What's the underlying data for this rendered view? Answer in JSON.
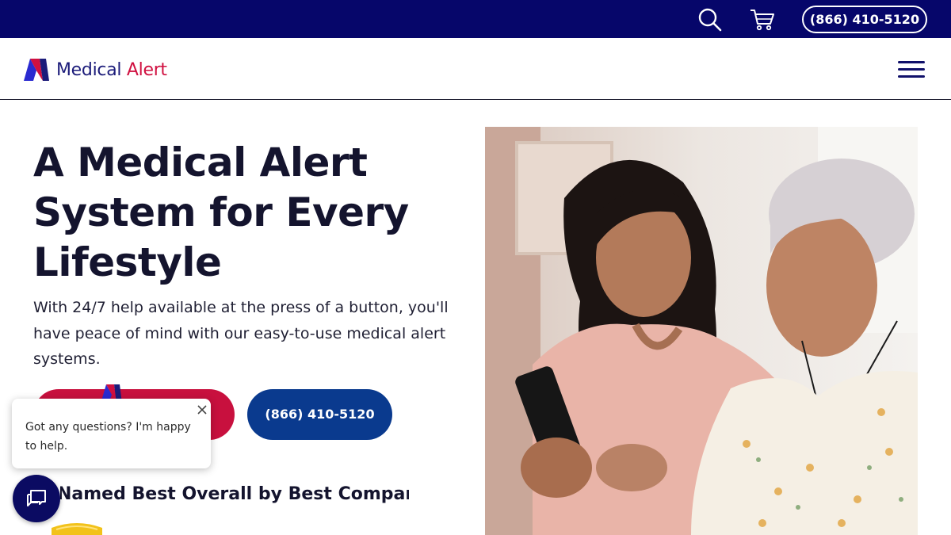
{
  "topbar": {
    "phone": "(866) 410-5120",
    "icons": [
      "search-icon",
      "cart-icon"
    ]
  },
  "header": {
    "logo_word1": "Medical",
    "logo_word2": "Alert",
    "menu_icon": "hamburger-menu-icon"
  },
  "hero": {
    "title": "A Medical Alert System for Every Lifestyle",
    "subtitle": "With 24/7 help available at the press of a button, you'll have peace of mind with our easy-to-use medical alert systems.",
    "phone_button": "(866) 410-5120"
  },
  "chat": {
    "message": "Got any questions? I'm happy to help."
  },
  "award": {
    "text": "Named Best Overall by Best Company"
  },
  "colors": {
    "navy": "#06066a",
    "brand_red": "#c8103e",
    "button_blue": "#0a3a8e"
  }
}
